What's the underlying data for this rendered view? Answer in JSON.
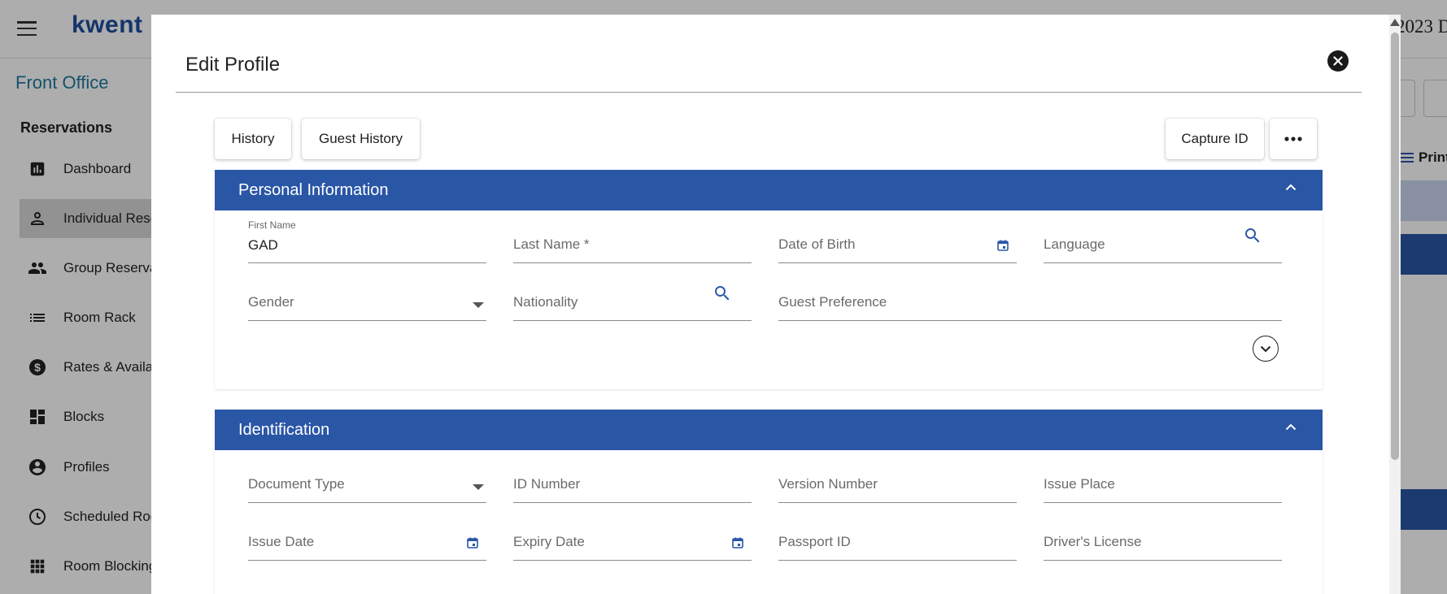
{
  "app": {
    "logo": "kwent",
    "header_date": "2023 D",
    "sidebar": {
      "title": "Front Office",
      "section": "Reservations",
      "items": [
        {
          "label": "Dashboard",
          "icon": "bar-chart-icon"
        },
        {
          "label": "Individual Rese",
          "icon": "person-icon"
        },
        {
          "label": "Group Reserva",
          "icon": "group-icon"
        },
        {
          "label": "Room Rack",
          "icon": "list-icon"
        },
        {
          "label": "Rates & Availa",
          "icon": "dollar-icon"
        },
        {
          "label": "Blocks",
          "icon": "dashboard-icon"
        },
        {
          "label": "Profiles",
          "icon": "account-circle-icon"
        },
        {
          "label": "Scheduled Roo",
          "icon": "clock-icon"
        },
        {
          "label": "Room Blocking",
          "icon": "grid-icon"
        }
      ]
    },
    "print_label": "Print"
  },
  "modal": {
    "title": "Edit Profile",
    "buttons": {
      "history": "History",
      "guest_history": "Guest History",
      "capture_id": "Capture ID"
    },
    "personal": {
      "header": "Personal Information",
      "first_name_label": "First Name",
      "first_name_value": "GAD",
      "last_name": "Last Name *",
      "dob": "Date of Birth",
      "language": "Language",
      "gender": "Gender",
      "nationality": "Nationality",
      "guest_preference": "Guest Preference"
    },
    "identification": {
      "header": "Identification",
      "document_type": "Document Type",
      "id_number": "ID Number",
      "version_number": "Version Number",
      "issue_place": "Issue Place",
      "issue_date": "Issue Date",
      "expiry_date": "Expiry Date",
      "passport_id": "Passport ID",
      "drivers_license": "Driver's License"
    }
  },
  "colors": {
    "primary": "#2a56a6",
    "brand_text": "#1e4fa0",
    "sidebar_title": "#1f7aa0"
  }
}
